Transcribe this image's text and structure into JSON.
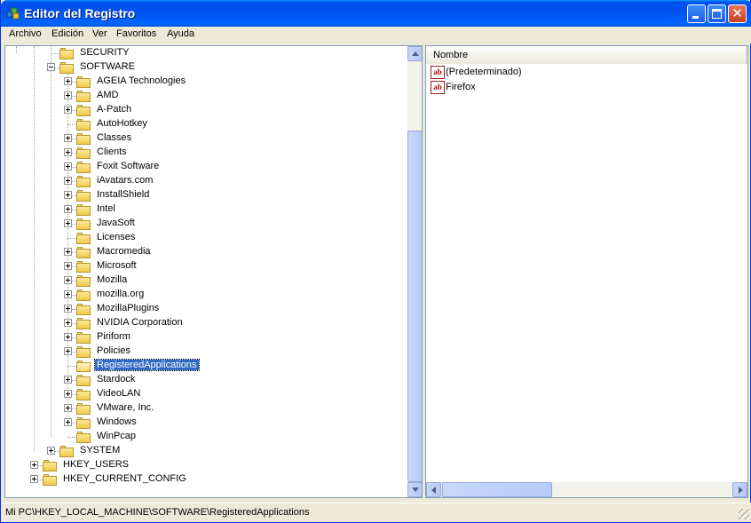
{
  "window": {
    "title": "Editor del Registro",
    "icon": "registry-editor-icon",
    "controls": {
      "minimize": "minimize-icon",
      "maximize": "maximize-icon",
      "close": "✕"
    }
  },
  "menu": [
    "Archivo",
    "Edición",
    "Ver",
    "Favoritos",
    "Ayuda"
  ],
  "tree": {
    "nodes": [
      {
        "label": "SECURITY",
        "level": 2,
        "expander": "none"
      },
      {
        "label": "SOFTWARE",
        "level": 2,
        "expander": "minus"
      },
      {
        "label": "AGEIA Technologies",
        "level": 3,
        "expander": "plus"
      },
      {
        "label": "AMD",
        "level": 3,
        "expander": "plus"
      },
      {
        "label": "A-Patch",
        "level": 3,
        "expander": "plus"
      },
      {
        "label": "AutoHotkey",
        "level": 3,
        "expander": "none"
      },
      {
        "label": "Classes",
        "level": 3,
        "expander": "plus"
      },
      {
        "label": "Clients",
        "level": 3,
        "expander": "plus"
      },
      {
        "label": "Foxit Software",
        "level": 3,
        "expander": "plus"
      },
      {
        "label": "iAvatars.com",
        "level": 3,
        "expander": "plus"
      },
      {
        "label": "InstallShield",
        "level": 3,
        "expander": "plus"
      },
      {
        "label": "Intel",
        "level": 3,
        "expander": "plus"
      },
      {
        "label": "JavaSoft",
        "level": 3,
        "expander": "plus"
      },
      {
        "label": "Licenses",
        "level": 3,
        "expander": "none"
      },
      {
        "label": "Macromedia",
        "level": 3,
        "expander": "plus"
      },
      {
        "label": "Microsoft",
        "level": 3,
        "expander": "plus"
      },
      {
        "label": "Mozilla",
        "level": 3,
        "expander": "plus"
      },
      {
        "label": "mozilla.org",
        "level": 3,
        "expander": "plus"
      },
      {
        "label": "MozillaPlugins",
        "level": 3,
        "expander": "plus"
      },
      {
        "label": "NVIDIA Corporation",
        "level": 3,
        "expander": "plus"
      },
      {
        "label": "Piriform",
        "level": 3,
        "expander": "plus"
      },
      {
        "label": "Policies",
        "level": 3,
        "expander": "plus"
      },
      {
        "label": "RegisteredApplications",
        "level": 3,
        "expander": "none",
        "selected": true
      },
      {
        "label": "Stardock",
        "level": 3,
        "expander": "plus"
      },
      {
        "label": "VideoLAN",
        "level": 3,
        "expander": "plus"
      },
      {
        "label": "VMware, Inc.",
        "level": 3,
        "expander": "plus"
      },
      {
        "label": "Windows",
        "level": 3,
        "expander": "plus"
      },
      {
        "label": "WinPcap",
        "level": 3,
        "expander": "none"
      },
      {
        "label": "SYSTEM",
        "level": 2,
        "expander": "plus"
      },
      {
        "label": "HKEY_USERS",
        "level": 1,
        "expander": "plus"
      },
      {
        "label": "HKEY_CURRENT_CONFIG",
        "level": 1,
        "expander": "plus"
      }
    ]
  },
  "list": {
    "columns": [
      "Nombre"
    ],
    "values": [
      {
        "name": "(Predeterminado)",
        "icon": "ab"
      },
      {
        "name": "Firefox",
        "icon": "ab"
      }
    ]
  },
  "statusbar": {
    "path": "Mi PC\\HKEY_LOCAL_MACHINE\\SOFTWARE\\RegisteredApplications"
  },
  "colors": {
    "titlebar": "#0054e3",
    "selection": "#316ac5",
    "folder": "#f0c94a"
  }
}
